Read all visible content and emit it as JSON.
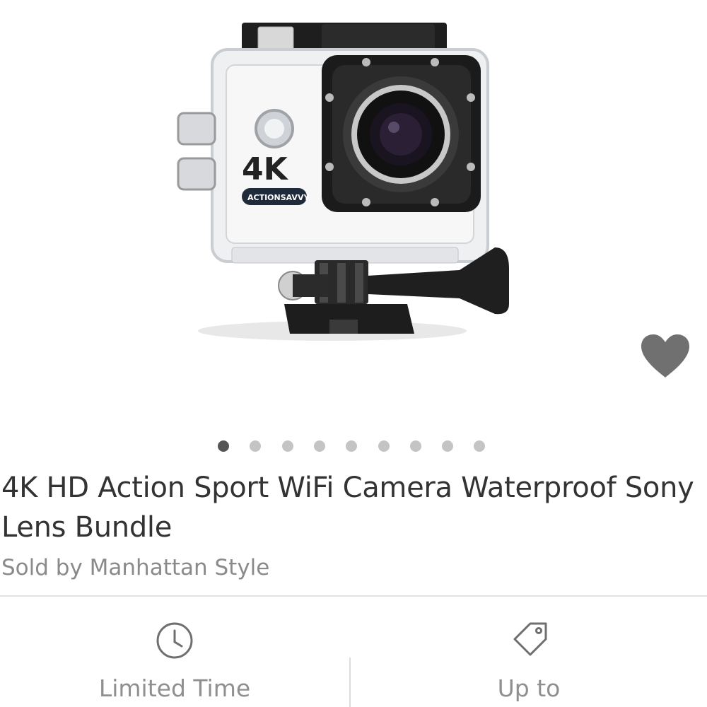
{
  "product": {
    "image_alt": "4K action camera in waterproof case with mount",
    "image_markings": {
      "resolution": "4K",
      "brand": "ACTIONSAVVY"
    },
    "title": "4K HD Action Sport WiFi Camera Waterproof Sony Lens Bundle",
    "seller": "Sold by Manhattan Style",
    "favorite_icon": "heart-icon"
  },
  "carousel": {
    "total": 9,
    "active_index": 0,
    "dot_color": "#c4c4c4",
    "active_dot_color": "#555555"
  },
  "info_bar": [
    {
      "icon": "clock-icon",
      "label": "Limited Time"
    },
    {
      "icon": "price-tag-icon",
      "label": "Up to"
    }
  ],
  "colors": {
    "text_primary": "#333333",
    "text_secondary": "#8a8a8a",
    "icon_gray": "#6f6f6f"
  }
}
